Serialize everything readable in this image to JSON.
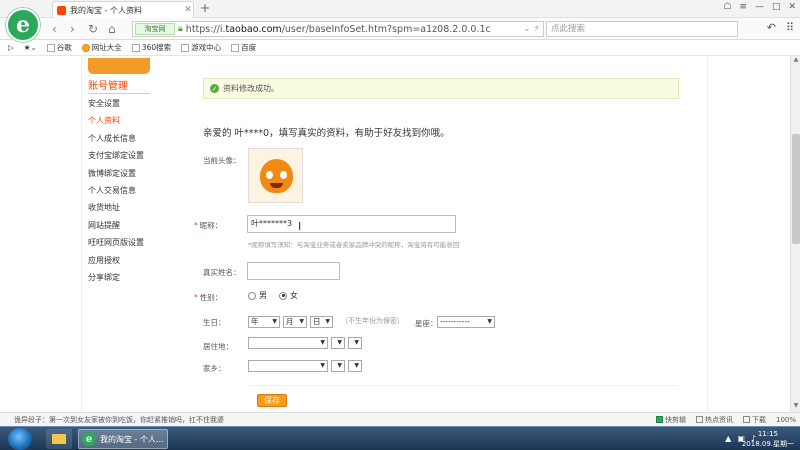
{
  "browser": {
    "tab_title": "我的淘宝 - 个人资料",
    "shield_label": "淘宝网",
    "url_prefix": "https://i.",
    "url_domain": "taobao.com",
    "url_path": "/user/baseInfoSet.htm?spm=a1z08.2.0.0.1c",
    "search_placeholder": "点此搜索"
  },
  "bookmarks": [
    {
      "label": "谷歌"
    },
    {
      "label": "网址大全"
    },
    {
      "label": "360搜索"
    },
    {
      "label": "游戏中心"
    },
    {
      "label": "百度"
    }
  ],
  "sidebar": {
    "title": "账号管理",
    "items": [
      {
        "label": "安全设置"
      },
      {
        "label": "个人资料"
      },
      {
        "label": "个人成长信息"
      },
      {
        "label": "支付宝绑定设置"
      },
      {
        "label": "微博绑定设置"
      },
      {
        "label": "个人交易信息"
      },
      {
        "label": "收货地址"
      },
      {
        "label": "网站提醒"
      },
      {
        "label": "旺旺网页版设置"
      },
      {
        "label": "应用授权"
      },
      {
        "label": "分享绑定"
      }
    ]
  },
  "form": {
    "success_message": "资料修改成功。",
    "greeting": "亲爱的 叶****0，填写真实的资料，有助于好友找到你哦。",
    "avatar_label": "当前头像：",
    "nickname_label": "昵称：",
    "nickname_value": "叶*******3",
    "nickname_hint": "*昵称填写须知：与淘宝业务或者卖家品牌冲突的昵称，淘宝将有可能收回",
    "realname_label": "真实姓名：",
    "gender_label": "性别：",
    "gender_male": "男",
    "gender_female": "女",
    "birthday_label": "生日：",
    "birth_year": "年",
    "birth_month": "月",
    "birth_day": "日",
    "birthday_hint": "（不生年份为保密）",
    "zodiac_label": "星座：",
    "zodiac_value": "-----------",
    "residence_label": "居住地：",
    "hometown_label": "家乡：",
    "save_label": "保存"
  },
  "statusbar": {
    "news": "诡异段子：第一次到女友家被你到吃饭，你赶紧推销吗，扛不住我婆",
    "items": [
      "快剪辑",
      "热点资讯",
      "下载",
      "100%"
    ]
  },
  "taskbar": {
    "app_label": "我的淘宝 - 个人...",
    "time": "11:15",
    "date": "2018.09.星期一"
  }
}
